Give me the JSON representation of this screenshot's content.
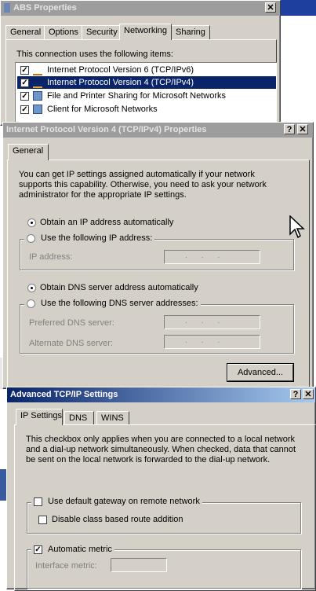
{
  "abs_window": {
    "title": "ABS Properties",
    "close_glyph": "✕",
    "tabs": [
      "General",
      "Options",
      "Security",
      "Networking",
      "Sharing"
    ],
    "uses_label": "This connection uses the following items:",
    "items": [
      {
        "label": "Internet Protocol Version 6 (TCP/IPv6)",
        "checked": true
      },
      {
        "label": "Internet Protocol Version 4 (TCP/IPv4)",
        "checked": true
      },
      {
        "label": "File and Printer Sharing for Microsoft Networks",
        "checked": true
      },
      {
        "label": "Client for Microsoft Networks",
        "checked": true
      }
    ]
  },
  "ipv4_window": {
    "title": "Internet Protocol Version 4 (TCP/IPv4) Properties",
    "help_glyph": "?",
    "close_glyph": "✕",
    "tab": "General",
    "description": "You can get IP settings assigned automatically if your network supports this capability. Otherwise, you need to ask your network administrator for the appropriate IP settings.",
    "obtain_ip_auto": "Obtain an IP address automatically",
    "use_following_ip": "Use the following IP address:",
    "ip_address_label": "IP address:",
    "obtain_dns_auto": "Obtain DNS server address automatically",
    "use_following_dns": "Use the following DNS server addresses:",
    "preferred_dns_label": "Preferred DNS server:",
    "alternate_dns_label": "Alternate DNS server:",
    "ip_dots": "...",
    "advanced_button": "Advanced..."
  },
  "advanced_window": {
    "title": "Advanced TCP/IP Settings",
    "help_glyph": "?",
    "close_glyph": "✕",
    "tabs": [
      "IP Settings",
      "DNS",
      "WINS"
    ],
    "description": "This checkbox only applies when you are connected to a local network and a dial-up network simultaneously.  When checked, data that cannot be sent on the local network is forwarded to the dial-up network.",
    "use_default_gateway": "Use default gateway on remote network",
    "disable_class_route": "Disable class based route addition",
    "automatic_metric": "Automatic metric",
    "interface_metric_label": "Interface metric:",
    "check_glyph": "✓"
  }
}
